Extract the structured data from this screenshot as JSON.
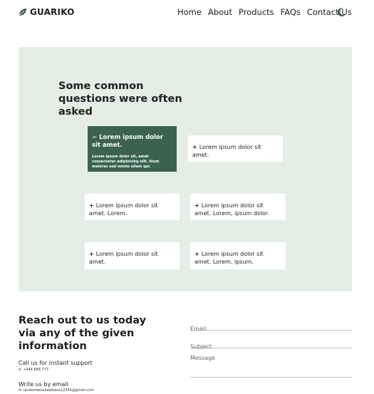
{
  "brand": {
    "name": "GUARIKO"
  },
  "nav": {
    "items": [
      "Home",
      "About",
      "Products",
      "FAQs",
      "Contact Us"
    ]
  },
  "theme_toggle": {
    "icon": "moon-icon"
  },
  "faq": {
    "title": "Some common questions were often asked",
    "items": [
      {
        "sign": "−",
        "question": "Lorem ipsum dolor sit amet.",
        "answer": "Lorem ipsum dolor sit, amet consectetur adipisicing elit. Illum maiores sed omnis ullam qui.",
        "expanded": true
      },
      {
        "sign": "+",
        "question": "Lorem ipsum dolor sit amet.",
        "expanded": false
      },
      {
        "sign": "+",
        "question": "Lorem ipsum dolor sit amet. Lorem.",
        "expanded": false
      },
      {
        "sign": "+",
        "question": "Lorem ipsum dolor sit amet. Lorem, ipsum dolor.",
        "expanded": false
      },
      {
        "sign": "+",
        "question": "Lorem ipsum dolor sit amet.",
        "expanded": false
      },
      {
        "sign": "+",
        "question": "Lorem ipsum dolor sit amet. Lorem, ipsum.",
        "expanded": false
      }
    ]
  },
  "contact": {
    "title": "Reach out to us today via any of the given information",
    "call_label": "Call us for instant support",
    "phone": "+444 666 777",
    "email_label": "Write us by email",
    "email": "randomemailaddress12345@gmail.com",
    "form": {
      "email_placeholder": "Email",
      "subject_placeholder": "Subject",
      "message_placeholder": "Message"
    }
  },
  "colors": {
    "accent": "#3b6251",
    "section_bg": "#e5ede7"
  }
}
